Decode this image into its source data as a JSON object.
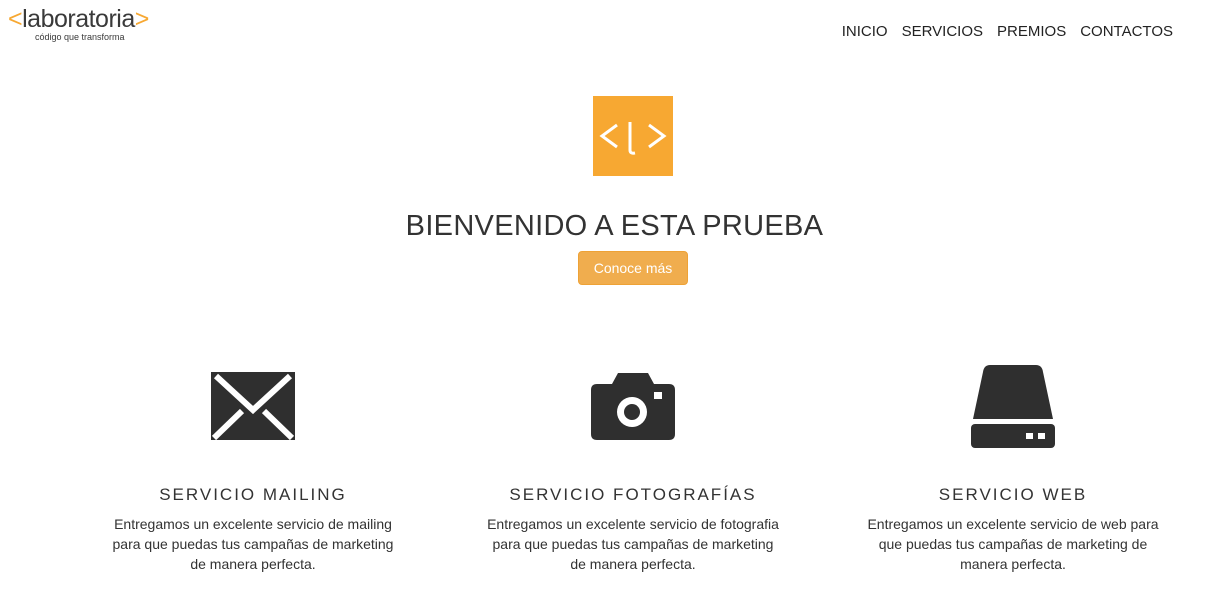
{
  "brand": {
    "lt": "<",
    "name": "laboratoria",
    "gt": ">",
    "tagline": "código que transforma",
    "accent_color": "#f7a832"
  },
  "nav": {
    "items": [
      {
        "label": "INICIO"
      },
      {
        "label": "SERVICIOS"
      },
      {
        "label": "PREMIOS"
      },
      {
        "label": "CONTACTOS"
      }
    ]
  },
  "hero": {
    "logo_icon": "laboratoria-logo-icon",
    "title": "BIENVENIDO A ESTA PRUEBA",
    "button_label": "Conoce más",
    "button_color": "#f0ad4e"
  },
  "services": [
    {
      "icon": "envelope-icon",
      "title": "SERVICIO MAILING",
      "description": "Entregamos un excelente servicio de mailing para que puedas tus campañas de marketing de manera perfecta."
    },
    {
      "icon": "camera-icon",
      "title": "SERVICIO FOTOGRAFÍAS",
      "description": "Entregamos un excelente servicio de fotografia para que puedas tus campañas de marketing de manera perfecta."
    },
    {
      "icon": "hard-drive-icon",
      "title": "SERVICIO WEB",
      "description": "Entregamos un excelente servicio de web para que puedas tus campañas de marketing de manera perfecta."
    }
  ]
}
